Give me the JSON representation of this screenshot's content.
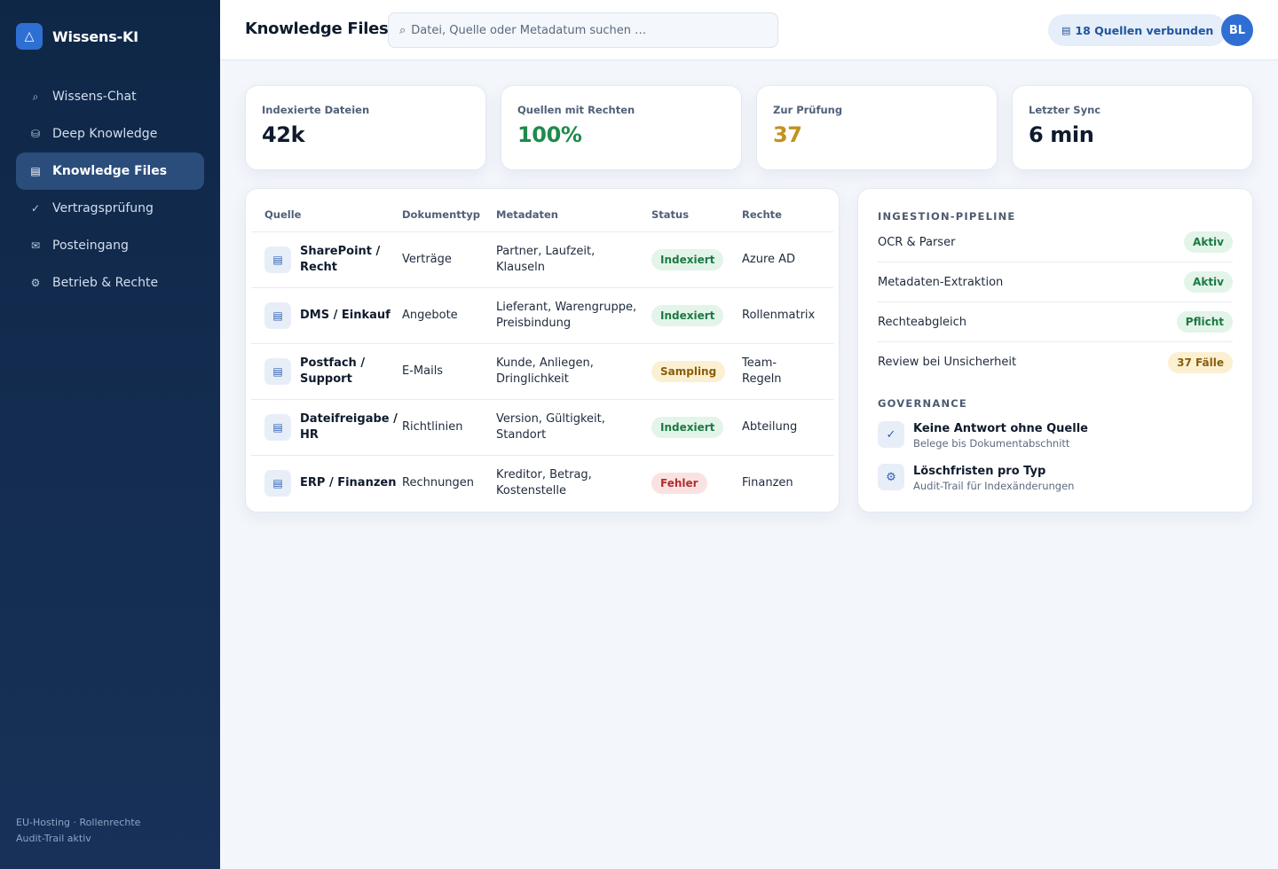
{
  "brand": {
    "name": "Wissens-KI",
    "logo_icon": "triangle-icon",
    "logo_glyph": "△"
  },
  "sidebar": {
    "items": [
      {
        "label": "Wissens-Chat",
        "icon": "search-icon",
        "glyph": "⌕",
        "active": false
      },
      {
        "label": "Deep Knowledge",
        "icon": "database-icon",
        "glyph": "⛁",
        "active": false
      },
      {
        "label": "Knowledge Files",
        "icon": "file-icon",
        "glyph": "▤",
        "active": true
      },
      {
        "label": "Vertragsprüfung",
        "icon": "check-icon",
        "glyph": "✓",
        "active": false
      },
      {
        "label": "Posteingang",
        "icon": "mail-icon",
        "glyph": "✉",
        "active": false
      },
      {
        "label": "Betrieb & Rechte",
        "icon": "gear-icon",
        "glyph": "⚙",
        "active": false
      }
    ],
    "footer_line1": "EU-Hosting · Rollenrechte",
    "footer_line2": "Audit-Trail aktiv"
  },
  "header": {
    "title": "Knowledge Files",
    "search_placeholder": "Datei, Quelle oder Metadatum suchen …",
    "search_glyph": "⌕",
    "sources_glyph": "▤",
    "sources_label": "18 Quellen verbunden",
    "avatar_initials": "BL"
  },
  "stats": [
    {
      "label": "Indexierte Dateien",
      "value": "42k",
      "color": "#0f1b2d"
    },
    {
      "label": "Quellen mit Rechten",
      "value": "100%",
      "color": "#1f8a4c"
    },
    {
      "label": "Zur Prüfung",
      "value": "37",
      "color": "#c2921f"
    },
    {
      "label": "Letzter Sync",
      "value": "6 min",
      "color": "#0f1b2d"
    }
  ],
  "table": {
    "headers": {
      "source": "Quelle",
      "type": "Dokumenttyp",
      "meta": "Metadaten",
      "status": "Status",
      "rights": "Rechte"
    },
    "row_glyph": "▤",
    "rows": [
      {
        "source_l1": "SharePoint /",
        "source_l2": "Recht",
        "type": "Verträge",
        "meta_l1": "Partner, Laufzeit,",
        "meta_l2": "Klauseln",
        "status": "Indexiert",
        "status_kind": "green",
        "rights_l1": "Azure AD",
        "rights_l2": ""
      },
      {
        "source_l1": "DMS / Einkauf",
        "source_l2": "",
        "type": "Angebote",
        "meta_l1": "Lieferant, Warengruppe,",
        "meta_l2": "Preisbindung",
        "status": "Indexiert",
        "status_kind": "green",
        "rights_l1": "Rollenmatrix",
        "rights_l2": ""
      },
      {
        "source_l1": "Postfach /",
        "source_l2": "Support",
        "type": "E-Mails",
        "meta_l1": "Kunde, Anliegen,",
        "meta_l2": "Dringlichkeit",
        "status": "Sampling",
        "status_kind": "amber",
        "rights_l1": "Team-",
        "rights_l2": "Regeln"
      },
      {
        "source_l1": "Dateifreigabe /",
        "source_l2": "HR",
        "type": "Richtlinien",
        "meta_l1": "Version, Gültigkeit,",
        "meta_l2": "Standort",
        "status": "Indexiert",
        "status_kind": "green",
        "rights_l1": "Abteilung",
        "rights_l2": ""
      },
      {
        "source_l1": "ERP / Finanzen",
        "source_l2": "",
        "type": "Rechnungen",
        "meta_l1": "Kreditor, Betrag,",
        "meta_l2": "Kostenstelle",
        "status": "Fehler",
        "status_kind": "red",
        "rights_l1": "Finanzen",
        "rights_l2": ""
      }
    ]
  },
  "pipeline": {
    "title": "INGESTION-PIPELINE",
    "items": [
      {
        "label": "OCR & Parser",
        "badge": "Aktiv",
        "kind": "green"
      },
      {
        "label": "Metadaten-Extraktion",
        "badge": "Aktiv",
        "kind": "green"
      },
      {
        "label": "Rechteabgleich",
        "badge": "Pflicht",
        "kind": "green"
      },
      {
        "label": "Review bei Unsicherheit",
        "badge": "37 Fälle",
        "kind": "amber"
      }
    ]
  },
  "governance": {
    "title": "GOVERNANCE",
    "items": [
      {
        "title": "Keine Antwort ohne Quelle",
        "subtitle": "Belege bis Dokumentabschnitt",
        "icon": "check-icon",
        "glyph": "✓"
      },
      {
        "title": "Löschfristen pro Typ",
        "subtitle": "Audit-Trail für Indexänderungen",
        "icon": "gear-icon",
        "glyph": "⚙"
      }
    ]
  }
}
